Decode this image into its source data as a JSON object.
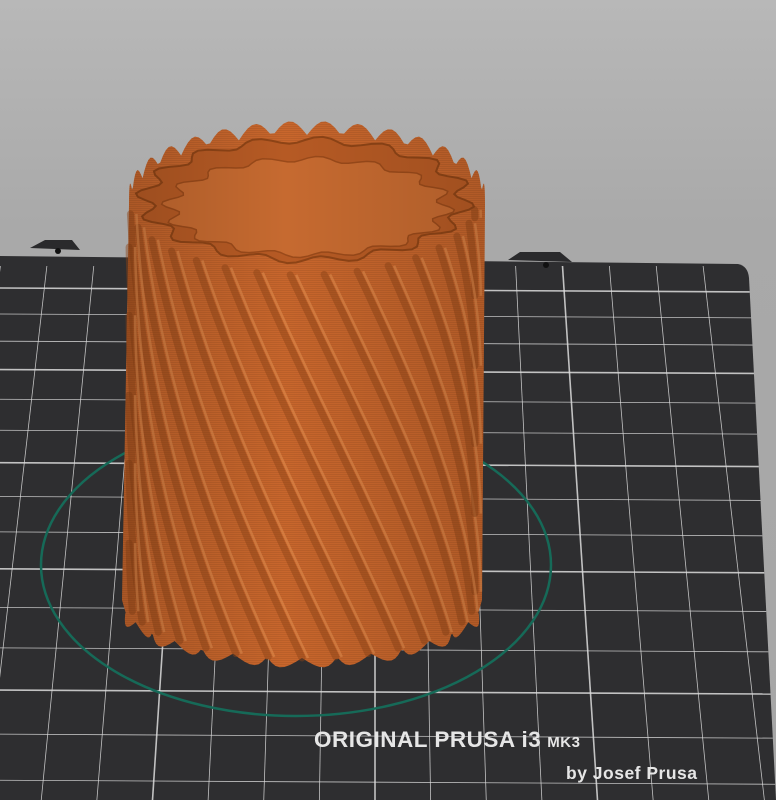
{
  "viewport": {
    "background": "#a6a6a6",
    "bed_color": "#2e2e30",
    "grid_color": "#dcdcdc",
    "print_color": "#c8662c",
    "skirt_color": "#166a58"
  },
  "bed_label": {
    "brand": "ORIGINAL PRUSA i3",
    "model": "MK3",
    "byline": "by Josef Prusa"
  },
  "object": {
    "shape": "twisted-fluted-vase",
    "flute_count": 16
  }
}
